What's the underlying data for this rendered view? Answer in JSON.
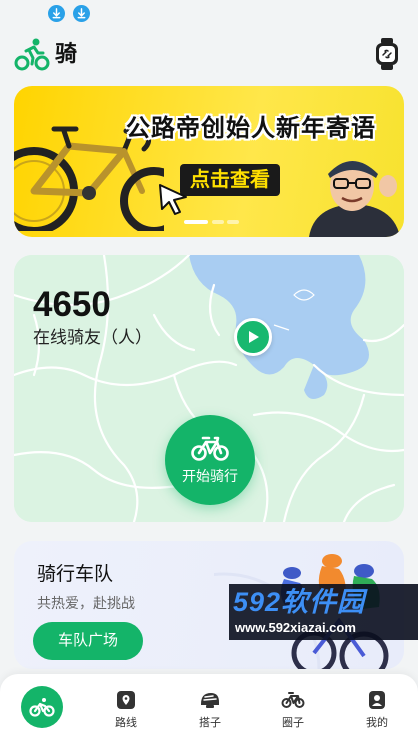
{
  "header": {
    "title": "骑"
  },
  "banner": {
    "title": "公路帝创始人新年寄语",
    "cta": "点击查看",
    "slide_count": 3,
    "active_slide": 1
  },
  "map_card": {
    "online_count": "4650",
    "online_label": "在线骑友（人）",
    "start_label": "开始骑行"
  },
  "team_card": {
    "title": "骑行车队",
    "subtitle": "共热爱，赴挑战",
    "button": "车队广场"
  },
  "watermark": {
    "brand": "592软件园",
    "url": "www.592xiazai.com"
  },
  "tab_bar": {
    "items": [
      {
        "label": "",
        "icon": "bike-icon",
        "active": true
      },
      {
        "label": "路线",
        "icon": "route-map-icon",
        "active": false
      },
      {
        "label": "搭子",
        "icon": "helmet-icon",
        "active": false
      },
      {
        "label": "圈子",
        "icon": "bicycle-icon",
        "active": false
      },
      {
        "label": "我的",
        "icon": "user-icon",
        "active": false
      }
    ]
  },
  "colors": {
    "brand_green": "#14b469",
    "banner_yellow": "#ffd400",
    "map_green": "#dbf3e2",
    "lake_blue": "#a9cdf2"
  }
}
